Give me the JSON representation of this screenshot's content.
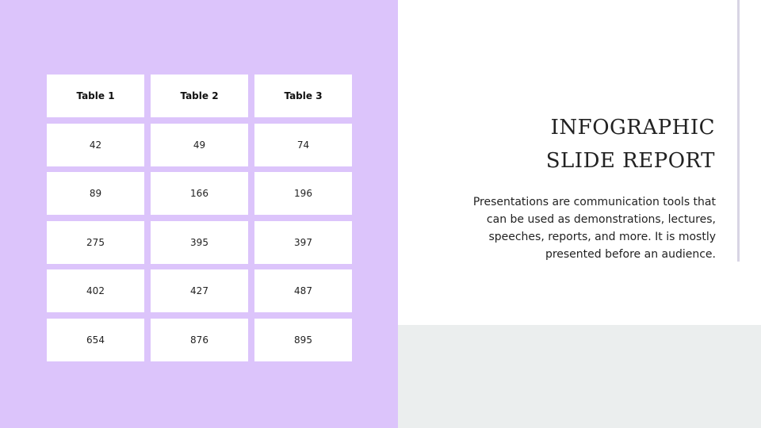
{
  "slide": {
    "title_lines": [
      "INFOGRAPHIC",
      "SLIDE REPORT"
    ],
    "body": "Presentations are communication tools that can be used as demonstrations, lectures, speeches, reports, and more. It is mostly presented before an audience.",
    "colors": {
      "left_panel": "#dcc4fb",
      "bottom_panel": "#ebeeee",
      "accent_line": "#d8d4e4"
    }
  },
  "table": {
    "headers": [
      "Table 1",
      "Table 2",
      "Table 3"
    ],
    "rows": [
      [
        "42",
        "49",
        "74"
      ],
      [
        "89",
        "166",
        "196"
      ],
      [
        "275",
        "395",
        "397"
      ],
      [
        "402",
        "427",
        "487"
      ],
      [
        "654",
        "876",
        "895"
      ]
    ]
  }
}
